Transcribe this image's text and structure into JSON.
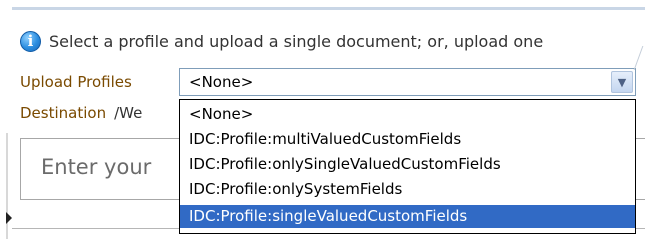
{
  "info": {
    "message": "Select a profile and upload a single document; or, upload one"
  },
  "form": {
    "upload_profiles_label": "Upload Profiles",
    "upload_profiles_value": "<None>",
    "destination_label": "Destination",
    "destination_value": "/We",
    "enter_placeholder": "Enter your"
  },
  "dropdown": {
    "options": [
      "<None>",
      "IDC:Profile:multiValuedCustomFields",
      "IDC:Profile:onlySingleValuedCustomFields",
      "IDC:Profile:onlySystemFields",
      "IDC:Profile:singleValuedCustomFields"
    ],
    "highlighted_index": 4
  },
  "colors": {
    "label": "#7a4a00",
    "highlight": "#316ac5",
    "info_icon": "#2c8ee0"
  },
  "icons": {
    "info": "info-icon",
    "dropdown_arrow": "chevron-down-icon",
    "splitter": "triangle-right-icon"
  }
}
